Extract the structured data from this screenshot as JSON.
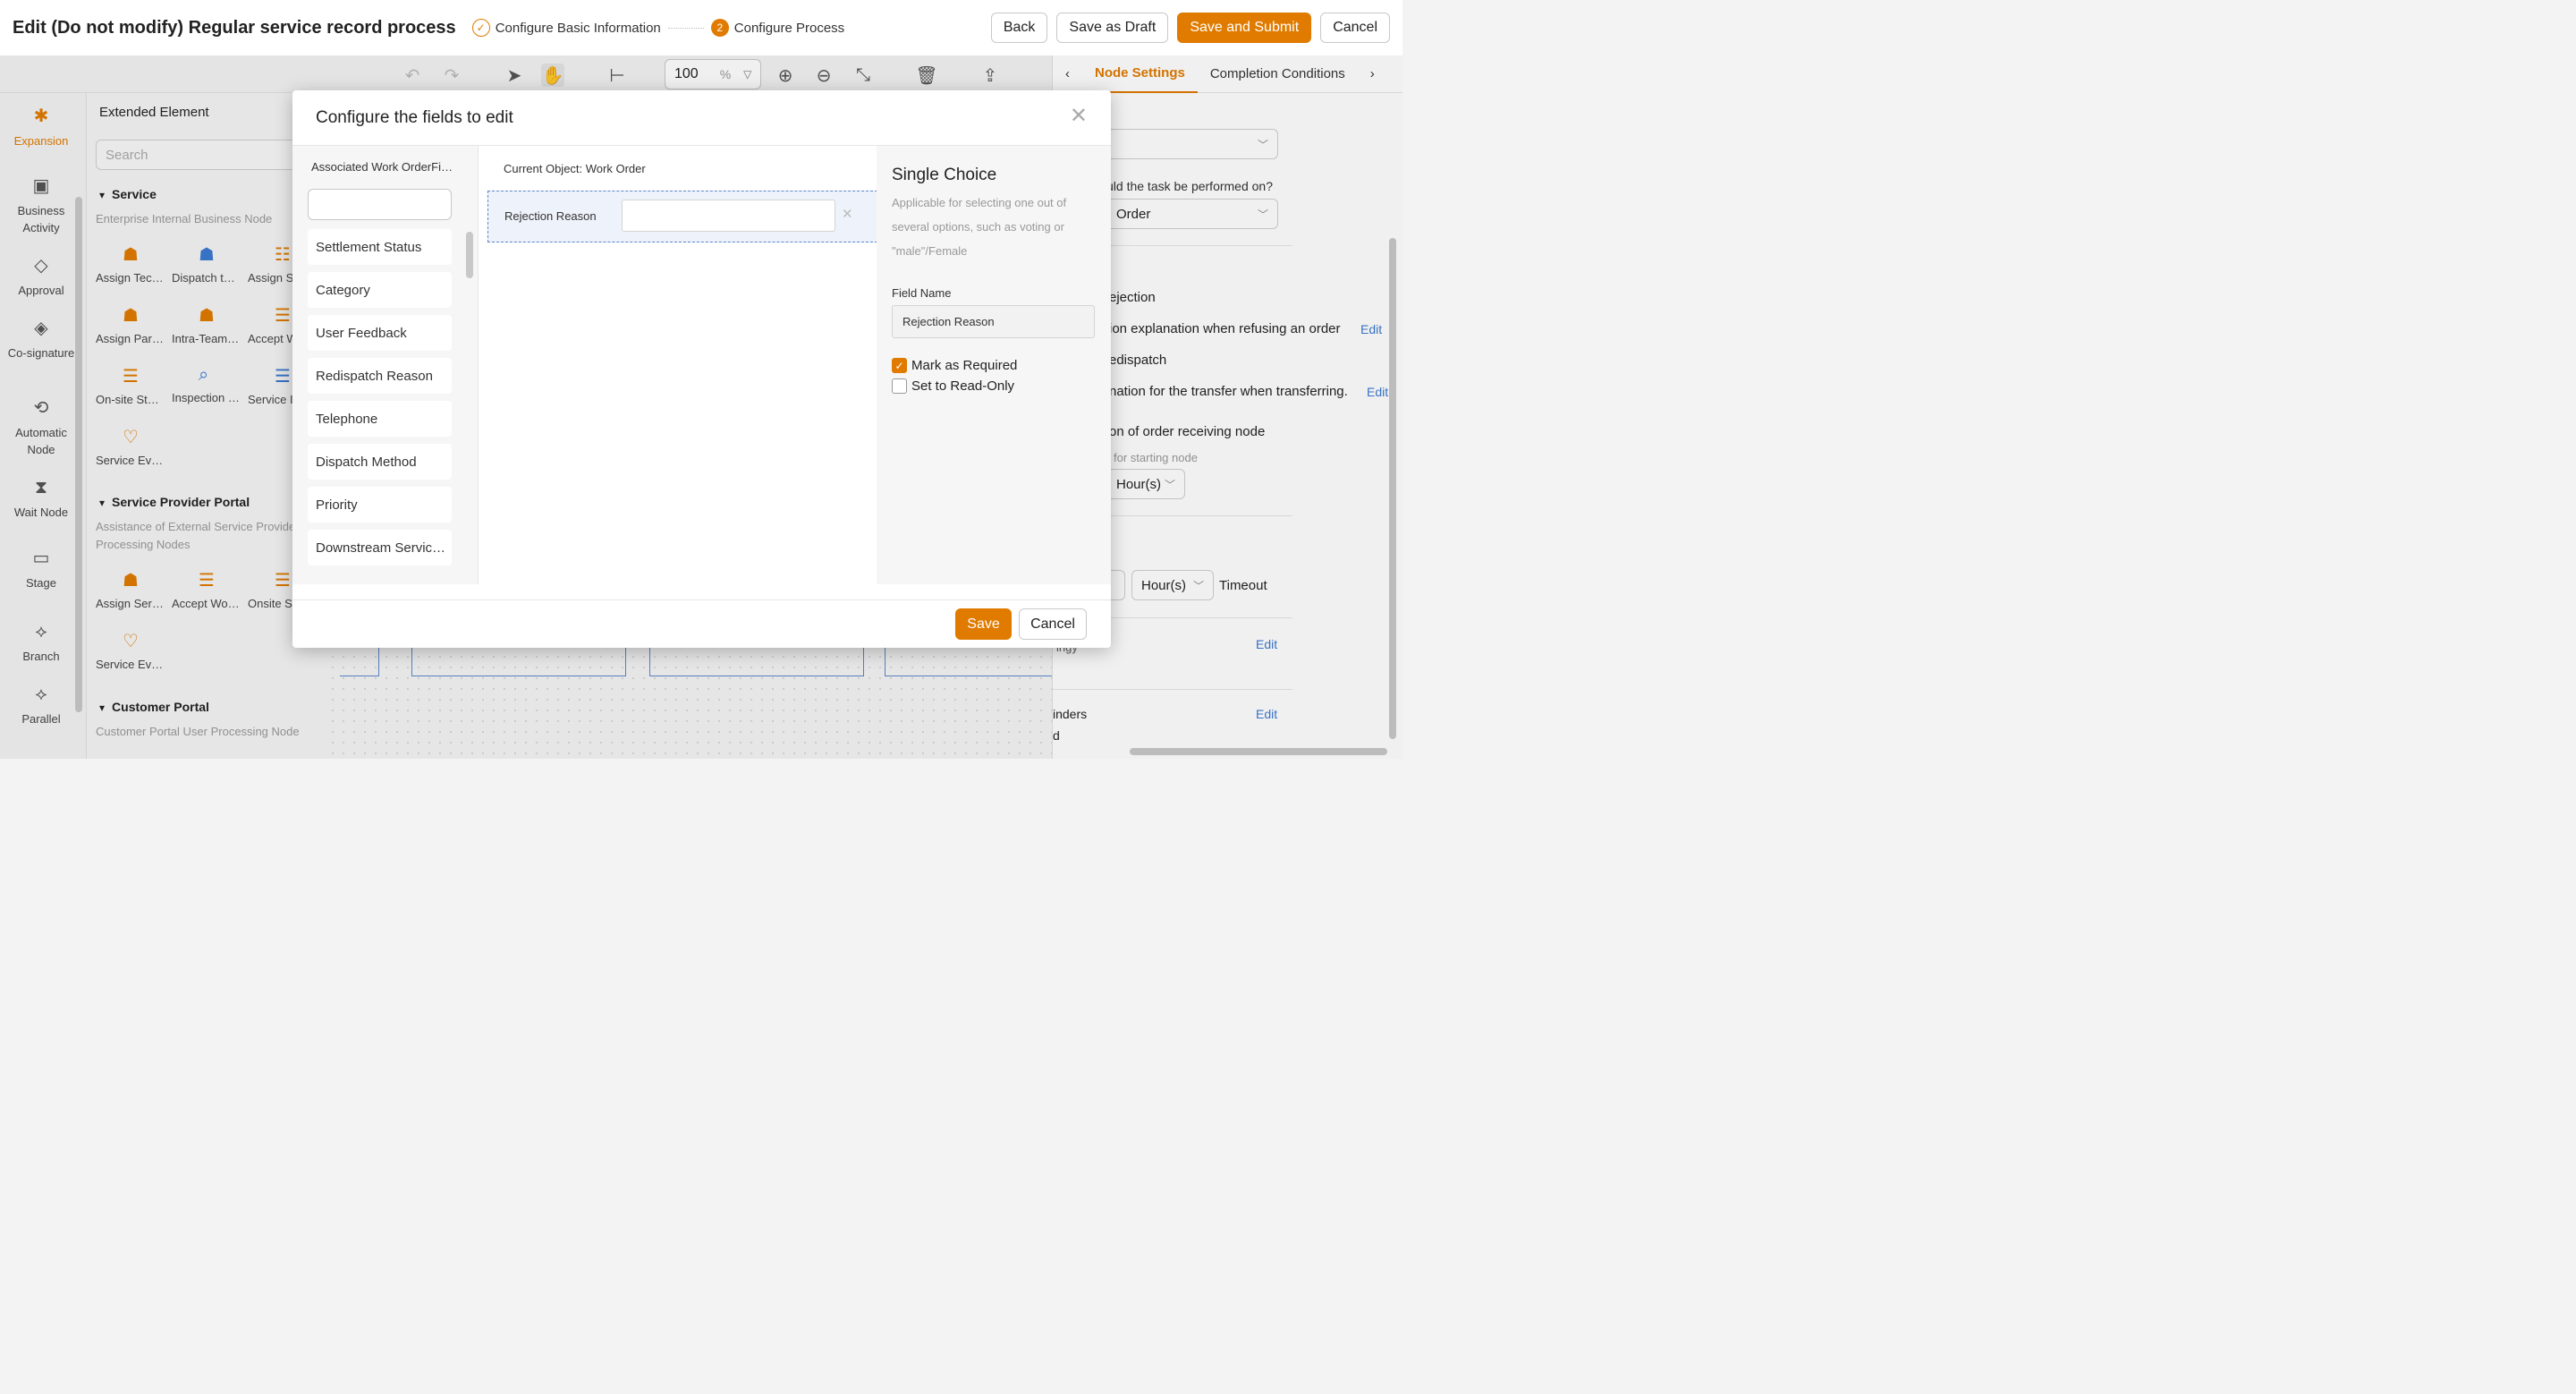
{
  "header": {
    "title": "Edit (Do not modify) Regular service record process",
    "steps": [
      {
        "label": "Configure Basic Information",
        "state": "done",
        "icon": "check-icon"
      },
      {
        "label": "Configure Process",
        "state": "current",
        "number": "2"
      }
    ],
    "buttons": {
      "back": "Back",
      "save_draft": "Save as Draft",
      "save_submit": "Save and Submit",
      "cancel": "Cancel"
    }
  },
  "toolbar": {
    "zoom_value": "100",
    "zoom_unit": "%"
  },
  "rail": {
    "items": [
      {
        "label": "Expansion",
        "icon": "puzzle-icon",
        "active": true
      },
      {
        "label": "Business Activity",
        "icon": "person-card-icon"
      },
      {
        "label": "Approval",
        "icon": "diamond-check-icon"
      },
      {
        "label": "Co-signature",
        "icon": "diamond-pen-icon"
      },
      {
        "label": "Automatic Node",
        "icon": "auto-refresh-icon"
      },
      {
        "label": "Wait Node",
        "icon": "hourglass-icon"
      },
      {
        "label": "Stage",
        "icon": "stage-icon"
      },
      {
        "label": "Branch",
        "icon": "diamond-x-icon"
      },
      {
        "label": "Parallel",
        "icon": "diamond-plus-icon"
      }
    ]
  },
  "palette": {
    "title": "Extended Element",
    "search_placeholder": "Search",
    "groups": [
      {
        "name": "Service",
        "desc": "Enterprise Internal Business Node",
        "nodes": [
          "Assign Tec…",
          "Dispatch t…",
          "Assign S",
          "Assign Par…",
          "Intra-Team…",
          "Accept W",
          "On-site St…",
          "Inspection …",
          "Service I",
          "Service Ev…"
        ]
      },
      {
        "name": "Service Provider Portal",
        "desc": "Assistance of External Service Provider Processing Nodes",
        "nodes": [
          "Assign Ser…",
          "Accept Wo…",
          "Onsite S",
          "Service Ev…"
        ]
      },
      {
        "name": "Customer Portal",
        "desc": "Customer Portal User Processing Node"
      }
    ]
  },
  "right_panel": {
    "tabs": [
      "Node Settings",
      "Completion Conditions"
    ],
    "q_text": "uld the task be performed on?",
    "select_value": "Order",
    "rejection": "ejection",
    "rejection_expl": "ion explanation when refusing an order",
    "redispatch": "edispatch",
    "transfer_expl": "nation for the transfer when transferring.",
    "receiving": "on of order receiving node",
    "starting_node": "for starting node",
    "hour_unit": "Hour(s)",
    "hour_unit2": "Hour(s)",
    "timeout": "Timeout",
    "ingy": "ingy",
    "reminders": "inders",
    "d_text": "d",
    "edit": "Edit"
  },
  "modal": {
    "title": "Configure the fields to edit",
    "left_title": "Associated Work OrderFi…",
    "fields": [
      "Settlement Status",
      "Category",
      "User Feedback",
      "Redispatch Reason",
      "Telephone",
      "Dispatch Method",
      "Priority",
      "Downstream Servic…"
    ],
    "current_object": "Current Object: Work Order",
    "field_row_label": "Rejection Reason",
    "props": {
      "type_title": "Single Choice",
      "type_desc": "Applicable for selecting one out of several options, such as voting or \"male\"/Female",
      "field_name_label": "Field Name",
      "field_name_value": "Rejection Reason",
      "required_label": "Mark as Required",
      "required": true,
      "readonly_label": "Set to Read-Only",
      "readonly": false
    },
    "save": "Save",
    "cancel": "Cancel"
  }
}
